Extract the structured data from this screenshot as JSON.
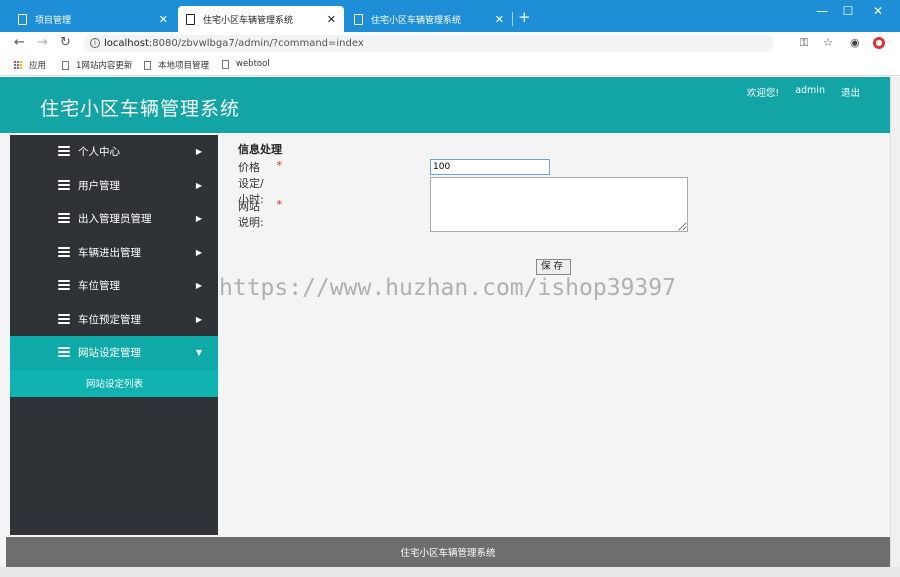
{
  "browser": {
    "tabs": [
      {
        "title": "项目管理",
        "close": "✕"
      },
      {
        "title": "住宅小区车辆管理系统",
        "close": "✕"
      },
      {
        "title": "住宅小区车辆管理系统",
        "close": "✕"
      }
    ],
    "new_tab": "+",
    "window_controls": {
      "minimize": "—",
      "maximize": "☐",
      "close": "✕"
    },
    "url_host": "localhost",
    "url_rest": ":8080/zbvwlbga7/admin/?command=index",
    "bookmarks": [
      "应用",
      "1网站内容更新",
      "本地项目管理",
      "webtool"
    ]
  },
  "header": {
    "title": "住宅小区车辆管理系统",
    "links": [
      "欢迎您!",
      "admin",
      "退出"
    ]
  },
  "sidebar": {
    "items": [
      {
        "label": "个人中心",
        "arrow": "▶"
      },
      {
        "label": "用户管理",
        "arrow": "▶"
      },
      {
        "label": "出入管理员管理",
        "arrow": "▶"
      },
      {
        "label": "车辆进出管理",
        "arrow": "▶"
      },
      {
        "label": "车位管理",
        "arrow": "▶"
      },
      {
        "label": "车位预定管理",
        "arrow": "▶"
      },
      {
        "label": "网站设定管理",
        "arrow": "▼"
      }
    ],
    "submenu": "网站设定列表"
  },
  "form": {
    "title": "信息处理",
    "price_label": "价格设定/小时:",
    "price_value": "100",
    "desc_label": "网站说明:",
    "required_mark": "*",
    "save_label": "保存"
  },
  "watermark": "https://www.huzhan.com/ishop39397",
  "footer": {
    "text": "住宅小区车辆管理系统"
  },
  "colors": {
    "header": "#13a5a5",
    "sidebar": "#2f3338",
    "active": "#0fa9a7",
    "footer": "#6e6e6e",
    "tabbar": "#1e8fd6"
  }
}
